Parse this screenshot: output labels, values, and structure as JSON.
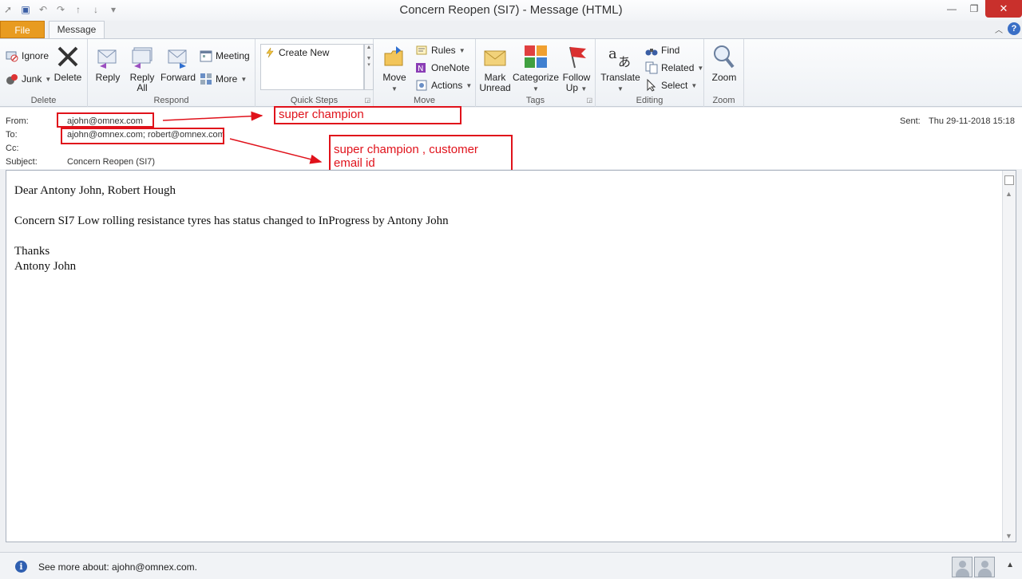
{
  "window": {
    "title": "Concern Reopen (SI7)  -  Message (HTML)"
  },
  "tabs": {
    "file": "File",
    "message": "Message"
  },
  "ribbon": {
    "delete_group": {
      "label": "Delete",
      "ignore": "Ignore",
      "junk": "Junk",
      "delete": "Delete"
    },
    "respond_group": {
      "label": "Respond",
      "reply": "Reply",
      "reply_all_1": "Reply",
      "reply_all_2": "All",
      "forward": "Forward",
      "meeting": "Meeting",
      "more": "More"
    },
    "quicksteps_group": {
      "label": "Quick Steps",
      "create_new": "Create New"
    },
    "move_group": {
      "label": "Move",
      "move": "Move",
      "rules": "Rules",
      "onenote": "OneNote",
      "actions": "Actions"
    },
    "tags_group": {
      "label": "Tags",
      "mark_1": "Mark",
      "mark_2": "Unread",
      "categorize": "Categorize",
      "follow_1": "Follow",
      "follow_2": "Up"
    },
    "editing_group": {
      "label": "Editing",
      "translate": "Translate",
      "find": "Find",
      "related": "Related",
      "select": "Select"
    },
    "zoom_group": {
      "label": "Zoom",
      "zoom": "Zoom"
    }
  },
  "header": {
    "from_label": "From:",
    "from_value": "ajohn@omnex.com",
    "to_label": "To:",
    "to_value": "ajohn@omnex.com; robert@omnex.com",
    "cc_label": "Cc:",
    "subject_label": "Subject:",
    "subject_value": "Concern Reopen (SI7)",
    "sent_label": "Sent:",
    "sent_value": "Thu 29-11-2018 15:18"
  },
  "annotations": {
    "from_note": "super  champion",
    "to_note_line1": "super champion , customer",
    "to_note_line2": "email id",
    "color": "#e0121b"
  },
  "message": {
    "greeting": "Dear Antony John, Robert Hough",
    "line1": "Concern SI7 Low rolling resistance tyres has status changed to InProgress by Antony John",
    "thanks": "Thanks",
    "signature": "Antony John"
  },
  "footer": {
    "info": "See more about: ajohn@omnex.com."
  },
  "colors": {
    "file_tab": "#e89b20",
    "close_button": "#c9302c",
    "accent_blue": "#2f5fb0"
  }
}
